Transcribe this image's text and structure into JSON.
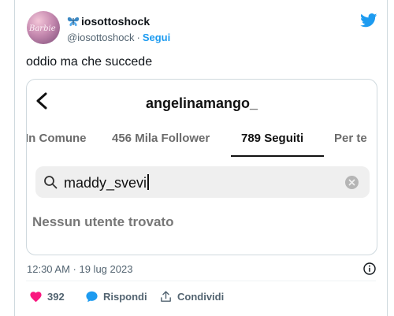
{
  "author": {
    "display_name": "iosottoshock",
    "handle": "@iosottoshock",
    "separator": "·",
    "follow_label": "Segui",
    "avatar_text": "Barbie"
  },
  "tweet": {
    "text": "oddio ma che succede",
    "timestamp": "12:30 AM · 19 lug 2023"
  },
  "embedded": {
    "profile_name": "angelinamango_",
    "tabs": [
      {
        "label": "In Comune",
        "active": false
      },
      {
        "label": "456 Mila Follower",
        "active": false
      },
      {
        "label": "789 Seguiti",
        "active": true
      },
      {
        "label": "Per te",
        "active": false
      }
    ],
    "search_value": "maddy_svevi",
    "empty_message": "Nessun utente trovato"
  },
  "actions": {
    "like_count": "392",
    "reply_label": "Rispondi",
    "share_label": "Condividi"
  },
  "colors": {
    "accent": "#1d9bf0",
    "like": "#f91880",
    "text": "#0f1419",
    "muted": "#536471"
  },
  "icons": {
    "bird": "twitter-bird-icon",
    "butterfly": "butterfly-emoji-icon",
    "back": "back-arrow-icon",
    "search": "search-icon",
    "clear": "clear-icon",
    "info": "info-icon",
    "like": "heart-icon",
    "reply": "reply-bubble-icon",
    "share": "share-icon"
  }
}
